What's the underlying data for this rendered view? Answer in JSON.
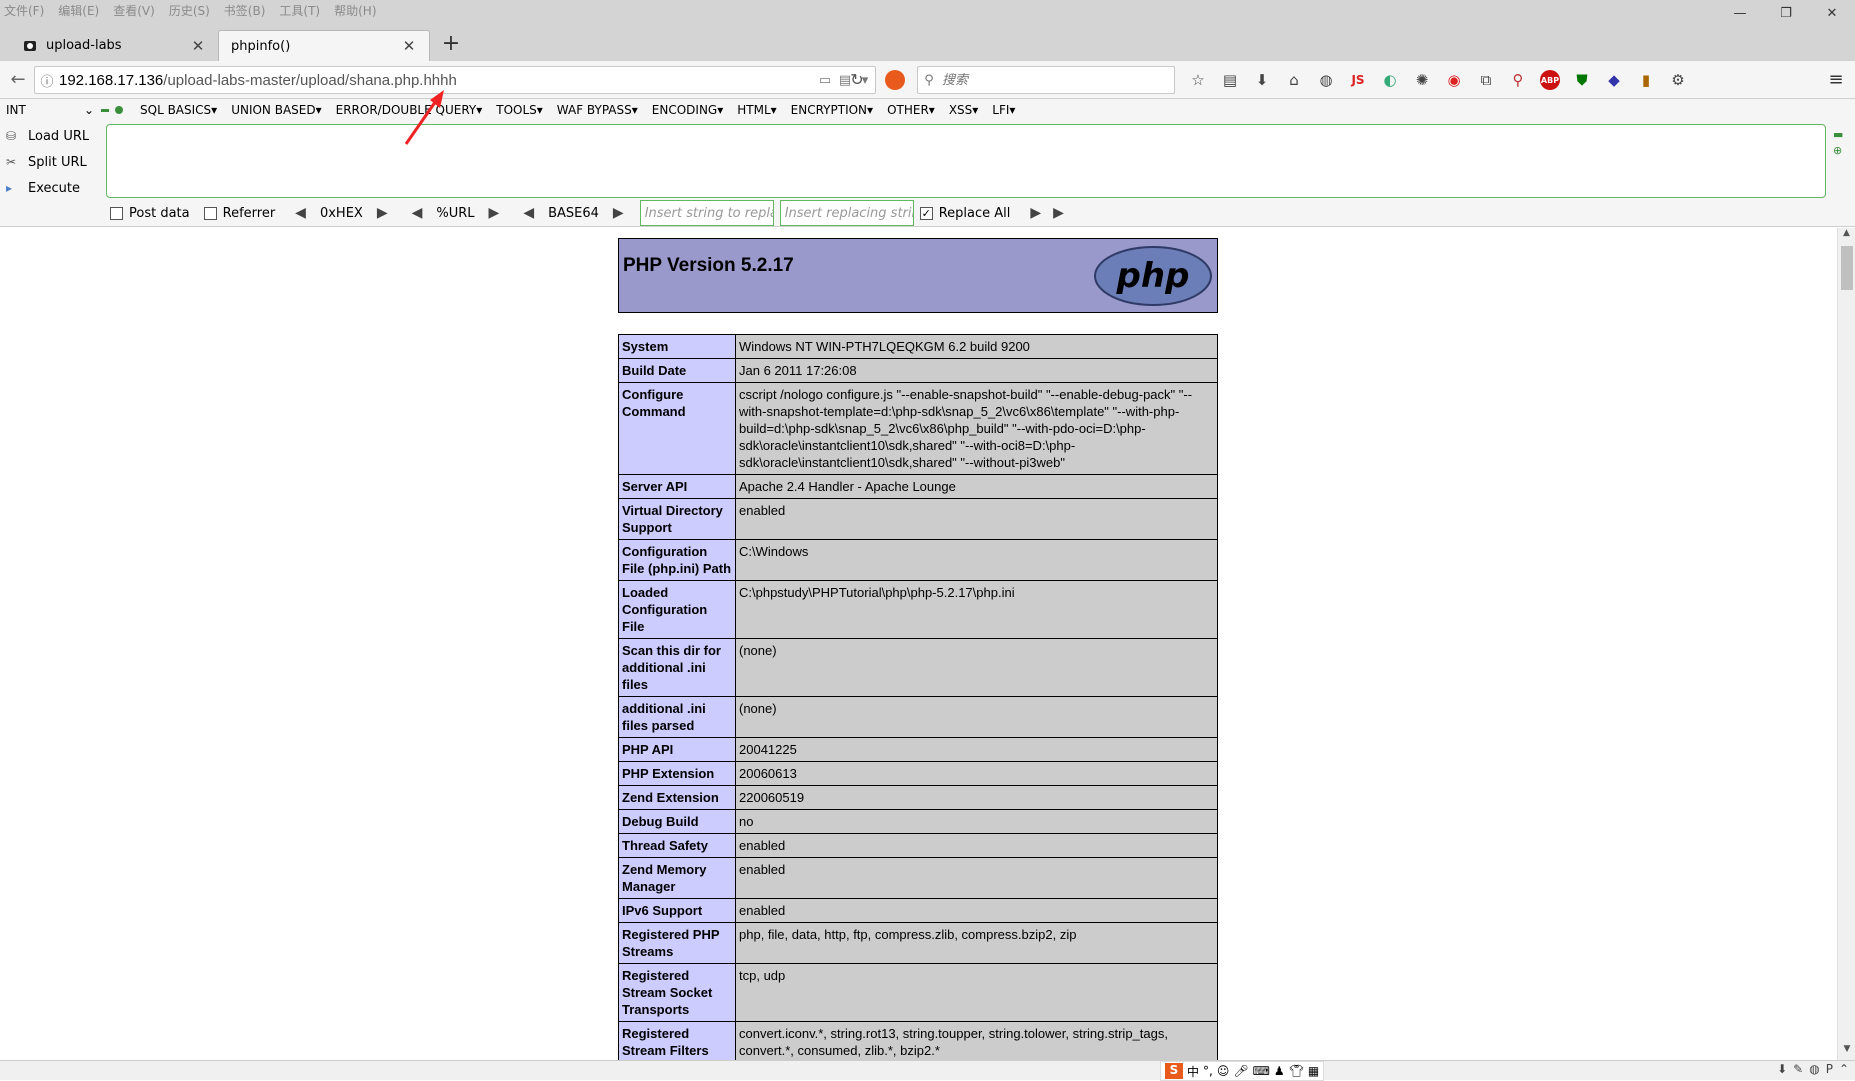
{
  "menubar": [
    "文件(F)",
    "编辑(E)",
    "查看(V)",
    "历史(S)",
    "书签(B)",
    "工具(T)",
    "帮助(H)"
  ],
  "window_controls": {
    "minimize": "—",
    "restore": "❐",
    "close": "✕"
  },
  "tabs": [
    {
      "title": "upload-labs",
      "active": false
    },
    {
      "title": "phpinfo()",
      "active": true
    }
  ],
  "newtab_label": "+",
  "url": {
    "host": "192.168.17.136",
    "path": "/upload-labs-master/upload/shana.php.hhhh"
  },
  "search": {
    "placeholder": "搜索"
  },
  "toolbar_icons": [
    "bookmark-star-icon",
    "reading-list-icon",
    "download-icon",
    "home-icon",
    "globe-icon",
    "js-icon",
    "translate-icon",
    "palette-icon",
    "ext-red-icon",
    "screenshot-icon",
    "zoom-icon",
    "abp-icon",
    "shield-icon",
    "diamond-icon",
    "colorpicker-icon",
    "settings-icon"
  ],
  "js_label": "JS",
  "abp_label": "ABP",
  "hackbar": {
    "type": "INT",
    "menus": [
      "SQL BASICS▾",
      "UNION BASED▾",
      "ERROR/DOUBLE QUERY▾",
      "TOOLS▾",
      "WAF BYPASS▾",
      "ENCODING▾",
      "HTML▾",
      "ENCRYPTION▾",
      "OTHER▾",
      "XSS▾",
      "LFI▾"
    ],
    "actions": [
      "Load URL",
      "Split URL",
      "Execute"
    ],
    "post_data": "Post data",
    "referrer": "Referrer",
    "hex": "0xHEX",
    "urlenc": "%URL",
    "base64": "BASE64",
    "replace_placeholder": "Insert string to replace",
    "replacing_placeholder": "Insert replacing string",
    "replace_all": "Replace All"
  },
  "php_version": "PHP Version 5.2.17",
  "php_logo_text": "php",
  "info_rows": [
    {
      "k": "System",
      "v": "Windows NT WIN-PTH7LQEQKGM 6.2 build 9200"
    },
    {
      "k": "Build Date",
      "v": "Jan 6 2011 17:26:08"
    },
    {
      "k": "Configure Command",
      "v": "cscript /nologo configure.js \"--enable-snapshot-build\" \"--enable-debug-pack\" \"--with-snapshot-template=d:\\php-sdk\\snap_5_2\\vc6\\x86\\template\" \"--with-php-build=d:\\php-sdk\\snap_5_2\\vc6\\x86\\php_build\" \"--with-pdo-oci=D:\\php-sdk\\oracle\\instantclient10\\sdk,shared\" \"--with-oci8=D:\\php-sdk\\oracle\\instantclient10\\sdk,shared\" \"--without-pi3web\""
    },
    {
      "k": "Server API",
      "v": "Apache 2.4 Handler - Apache Lounge"
    },
    {
      "k": "Virtual Directory Support",
      "v": "enabled"
    },
    {
      "k": "Configuration File (php.ini) Path",
      "v": "C:\\Windows"
    },
    {
      "k": "Loaded Configuration File",
      "v": "C:\\phpstudy\\PHPTutorial\\php\\php-5.2.17\\php.ini"
    },
    {
      "k": "Scan this dir for additional .ini files",
      "v": "(none)"
    },
    {
      "k": "additional .ini files parsed",
      "v": "(none)"
    },
    {
      "k": "PHP API",
      "v": "20041225"
    },
    {
      "k": "PHP Extension",
      "v": "20060613"
    },
    {
      "k": "Zend Extension",
      "v": "220060519"
    },
    {
      "k": "Debug Build",
      "v": "no"
    },
    {
      "k": "Thread Safety",
      "v": "enabled"
    },
    {
      "k": "Zend Memory Manager",
      "v": "enabled"
    },
    {
      "k": "IPv6 Support",
      "v": "enabled"
    },
    {
      "k": "Registered PHP Streams",
      "v": "php, file, data, http, ftp, compress.zlib, compress.bzip2, zip"
    },
    {
      "k": "Registered Stream Socket Transports",
      "v": "tcp, udp"
    },
    {
      "k": "Registered Stream Filters",
      "v": "convert.iconv.*, string.rot13, string.toupper, string.tolower, string.strip_tags, convert.*, consumed, zlib.*, bzip2.*"
    }
  ],
  "ime": {
    "logo": "S",
    "mode": "中"
  },
  "colors": {
    "php_header": "#9999cc",
    "php_key": "#ccccff",
    "php_value": "#cccccc",
    "hackbar_border": "#60b860"
  }
}
